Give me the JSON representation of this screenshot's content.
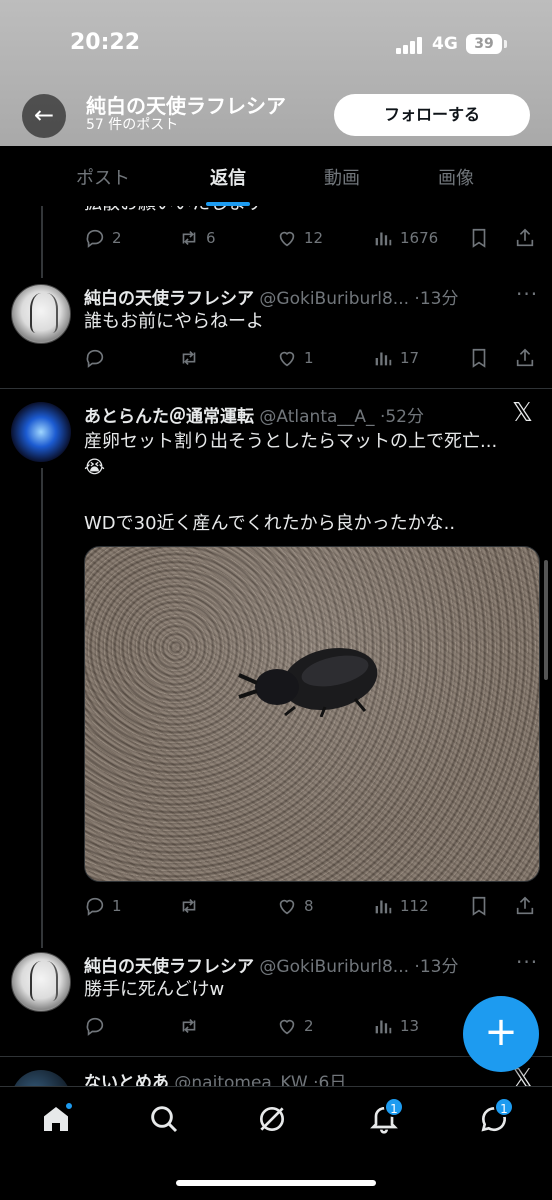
{
  "status_bar": {
    "time": "20:22",
    "network": "4G",
    "battery": "39"
  },
  "header": {
    "profile_name": "純白の天使ラフレシア",
    "post_count": "57 件のポスト",
    "follow_label": "フォローする"
  },
  "tabs": [
    {
      "label": "ポスト"
    },
    {
      "label": "返信",
      "active": true
    },
    {
      "label": "動画"
    },
    {
      "label": "画像"
    }
  ],
  "tweets": [
    {
      "text": "拡散お願いいたします",
      "actions": {
        "replies": "2",
        "retweets": "6",
        "likes": "12",
        "views": "1676"
      }
    },
    {
      "name": "純白の天使ラフレシア",
      "handle": "@GokiBuriburl8...",
      "time": "13分",
      "text": "誰もお前にやらねーよ",
      "actions": {
        "replies": "",
        "retweets": "",
        "likes": "1",
        "views": "17"
      }
    },
    {
      "name": "あとらんた＠通常運転",
      "handle": "@Atlanta__A_",
      "time": "52分",
      "text_line1": "産卵セット割り出そうとしたらマットの上で死亡...",
      "text_emoji": "😭",
      "text_line2": "WDで30近く産んでくれたから良かったかな..",
      "actions": {
        "replies": "1",
        "retweets": "",
        "likes": "8",
        "views": "112"
      }
    },
    {
      "name": "純白の天使ラフレシア",
      "handle": "@GokiBuriburl8...",
      "time": "13分",
      "text": "勝手に死んどけw",
      "actions": {
        "replies": "",
        "retweets": "",
        "likes": "2",
        "views": "13"
      }
    },
    {
      "name": "ないとめあ",
      "handle": "@naitomea_KW",
      "time": "6日"
    }
  ],
  "bottom_nav": {
    "notifications_badge": "1",
    "messages_badge": "1"
  },
  "colors": {
    "accent": "#1d9bf0",
    "background": "#000000",
    "muted": "#71767b"
  },
  "fab": {
    "label": "+"
  }
}
